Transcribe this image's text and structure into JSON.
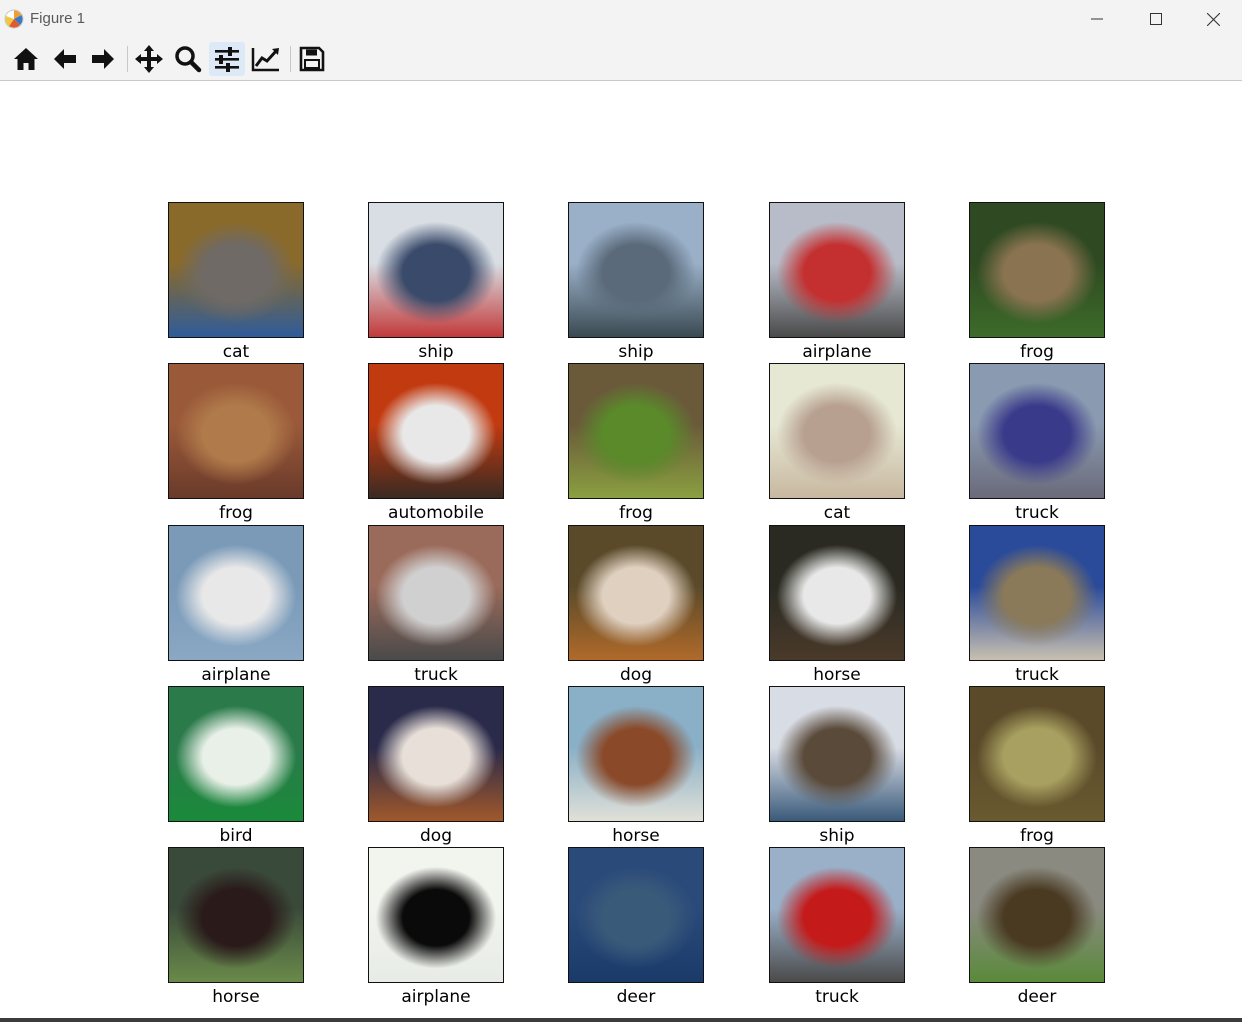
{
  "window": {
    "title": "Figure 1",
    "icons": {
      "app": "matplotlib-icon",
      "minimize": "minimize-icon",
      "maximize": "maximize-icon",
      "close": "close-icon"
    }
  },
  "toolbar": {
    "tools": [
      {
        "name": "home",
        "icon": "home-icon",
        "active": false
      },
      {
        "name": "back",
        "icon": "arrow-left-icon",
        "active": false
      },
      {
        "name": "forward",
        "icon": "arrow-right-icon",
        "active": false
      },
      {
        "name": "pan",
        "icon": "move-icon",
        "active": false
      },
      {
        "name": "zoom",
        "icon": "magnifier-icon",
        "active": false
      },
      {
        "name": "subplots",
        "icon": "sliders-icon",
        "active": true
      },
      {
        "name": "customize",
        "icon": "line-chart-icon",
        "active": false
      },
      {
        "name": "save",
        "icon": "save-icon",
        "active": false
      }
    ]
  },
  "grid": {
    "rows": 5,
    "cols": 5,
    "labels": [
      "cat",
      "ship",
      "ship",
      "airplane",
      "frog",
      "frog",
      "automobile",
      "frog",
      "cat",
      "truck",
      "airplane",
      "truck",
      "dog",
      "horse",
      "truck",
      "bird",
      "dog",
      "horse",
      "ship",
      "frog",
      "horse",
      "airplane",
      "deer",
      "truck",
      "deer"
    ],
    "palettes": [
      [
        "#8a6a2a",
        "#6f6a66",
        "#2f5c9a"
      ],
      [
        "#d8dee4",
        "#3a4a6a",
        "#c23a3a"
      ],
      [
        "#9ab0c8",
        "#5a6a7a",
        "#3a4a52"
      ],
      [
        "#b8bcc8",
        "#c43030",
        "#4a4a4a"
      ],
      [
        "#2f4a22",
        "#8a7350",
        "#3d6b2a"
      ],
      [
        "#9a5a3a",
        "#b07a4a",
        "#6a3a2a"
      ],
      [
        "#c23a10",
        "#e8e8e8",
        "#3a2a22"
      ],
      [
        "#6a5a3a",
        "#5a8a2a",
        "#8aa040"
      ],
      [
        "#e6e8d4",
        "#b8a090",
        "#c8b8a0"
      ],
      [
        "#8a9ab0",
        "#3a3a8a",
        "#6a6a7a"
      ],
      [
        "#7a9ab8",
        "#e8e8e8",
        "#8aa8c4"
      ],
      [
        "#9a6a5a",
        "#d0d0d0",
        "#4a4a4a"
      ],
      [
        "#5a4a2a",
        "#e0d0c0",
        "#b06a2a"
      ],
      [
        "#2a2a22",
        "#e8e8e8",
        "#4a3a2a"
      ],
      [
        "#2a4a9a",
        "#8a7a5a",
        "#c8c0b0"
      ],
      [
        "#2a7a4a",
        "#e8f0e8",
        "#1a8a3a"
      ],
      [
        "#2a2a4a",
        "#e8e0d8",
        "#a0582a"
      ],
      [
        "#8ab0c8",
        "#8a4a2a",
        "#e0e0d8"
      ],
      [
        "#d8dce4",
        "#5a4a3a",
        "#3a5a7a"
      ],
      [
        "#5a4a2a",
        "#a8a060",
        "#6a5a30"
      ],
      [
        "#3a4a3a",
        "#2a1a1a",
        "#6a8a4a"
      ],
      [
        "#f2f4ee",
        "#0a0a0a",
        "#e8ece6"
      ],
      [
        "#2a4a7a",
        "#3a5a7a",
        "#1a3a6a"
      ],
      [
        "#9ab0c8",
        "#c41a1a",
        "#4a4a4a"
      ],
      [
        "#8a8a80",
        "#4a3a22",
        "#5a8a3a"
      ]
    ]
  }
}
